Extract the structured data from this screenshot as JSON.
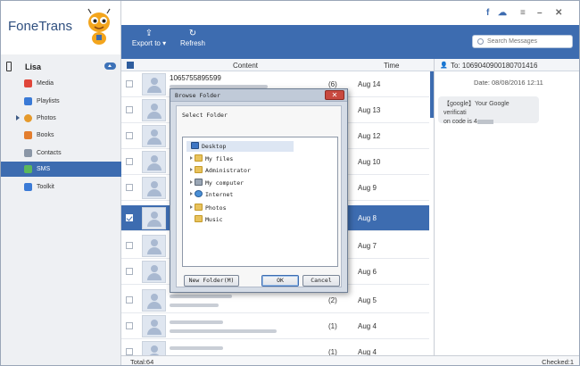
{
  "app": {
    "name": "FoneTrans"
  },
  "device": {
    "name": "Lisa"
  },
  "sidebar": {
    "items": [
      {
        "label": "Media",
        "icon": "media-icon",
        "color": "#e0463a"
      },
      {
        "label": "Playlists",
        "icon": "playlists-icon",
        "color": "#3a7ad6"
      },
      {
        "label": "Photos",
        "icon": "photos-icon",
        "color": "#e59a2c"
      },
      {
        "label": "Books",
        "icon": "books-icon",
        "color": "#e37e2e"
      },
      {
        "label": "Contacts",
        "icon": "contacts-icon",
        "color": "#8a96a6"
      },
      {
        "label": "SMS",
        "icon": "sms-icon",
        "color": "#5cb85c"
      },
      {
        "label": "Toolkit",
        "icon": "toolkit-icon",
        "color": "#3a7ad6"
      }
    ],
    "active": "SMS"
  },
  "toolbar": {
    "export_label": "Export to",
    "refresh_label": "Refresh"
  },
  "search": {
    "placeholder": "Search Messages"
  },
  "table": {
    "columns": [
      "Content",
      "Time"
    ],
    "rows": [
      {
        "number": "1065755895599",
        "count": "(6)",
        "date": "Aug 14",
        "selected": false
      },
      {
        "number": "",
        "count": "",
        "date": "Aug 13",
        "selected": false
      },
      {
        "number": "",
        "count": "",
        "date": "Aug 12",
        "selected": false
      },
      {
        "number": "",
        "count": "",
        "date": "Aug 10",
        "selected": false
      },
      {
        "number": "",
        "count": "",
        "date": "Aug 9",
        "selected": false
      },
      {
        "number": "",
        "count": "",
        "date": "Aug 8",
        "selected": true
      },
      {
        "number": "",
        "count": "",
        "date": "Aug 7",
        "selected": false
      },
      {
        "number": "",
        "count": "",
        "date": "Aug 6",
        "selected": false
      },
      {
        "number": "",
        "count": "(2)",
        "date": "Aug 5",
        "selected": false
      },
      {
        "number": "",
        "count": "(1)",
        "date": "Aug 4",
        "selected": false
      },
      {
        "number": "",
        "count": "(1)",
        "date": "Aug 4",
        "selected": false
      }
    ]
  },
  "conversation": {
    "to_label": "To: 1069040900180701416",
    "date": "Date: 08/08/2016 12:11",
    "message_line1": "【google】Your Google verificati",
    "message_line2": "on code is 4"
  },
  "status": {
    "total": "Total:64",
    "checked": "Checked:1"
  },
  "dialog": {
    "title": "Browse Folder",
    "prompt": "Select Folder",
    "tree": [
      {
        "label": "Desktop",
        "type": "desk",
        "expand": false
      },
      {
        "label": "My files",
        "type": "folder",
        "expand": true
      },
      {
        "label": "Administrator",
        "type": "user",
        "expand": true
      },
      {
        "label": "My computer",
        "type": "comp",
        "expand": true
      },
      {
        "label": "Internet",
        "type": "net",
        "expand": true
      },
      {
        "label": "Photos",
        "type": "folder",
        "expand": true
      },
      {
        "label": "Music",
        "type": "folder",
        "expand": false
      }
    ],
    "new_folder_label": "New Folder(M)",
    "ok_label": "OK",
    "cancel_label": "Cancel"
  },
  "theme": {
    "accent": "#3d6cb0"
  }
}
